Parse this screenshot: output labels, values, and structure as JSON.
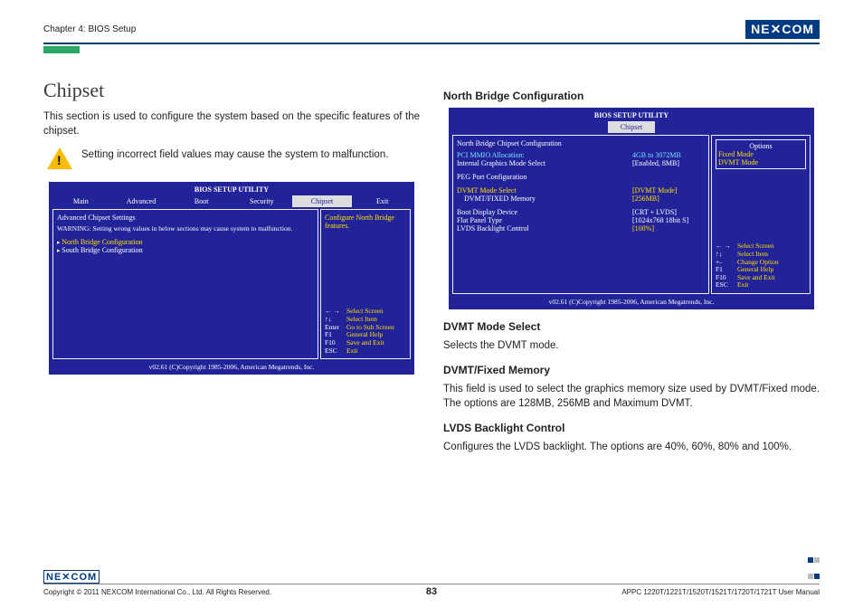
{
  "header": {
    "chapter": "Chapter 4: BIOS Setup",
    "brand": "NE COM"
  },
  "left": {
    "h1": "Chipset",
    "intro": "This section is used to configure the system based on the specific features of the chipset.",
    "warn": "Setting incorrect field values may cause the system to malfunction.",
    "bios": {
      "title": "BIOS SETUP UTILITY",
      "menu": [
        "Main",
        "Advanced",
        "Boot",
        "Security",
        "Chipset",
        "Exit"
      ],
      "menu_sel": "Chipset",
      "heading": "Advanced Chipset Settings",
      "warning": "WARNING: Setting wrong values in below sections may cause system to malfunction.",
      "items": [
        "North Bridge Configuration",
        "South Bridge Configuration"
      ],
      "help": "Configure North Bridge features.",
      "nav": [
        {
          "k": "← →",
          "v": "Select Screen"
        },
        {
          "k": "↑↓",
          "v": "Select Item"
        },
        {
          "k": "Enter",
          "v": "Go to Sub Screen"
        },
        {
          "k": "F1",
          "v": "General Help"
        },
        {
          "k": "F10",
          "v": "Save and Exit"
        },
        {
          "k": "ESC",
          "v": "Exit"
        }
      ],
      "copyright": "v02.61 (C)Copyright 1985-2006, American Megatrends, Inc."
    }
  },
  "right": {
    "h3a": "North Bridge Configuration",
    "bios": {
      "title": "BIOS SETUP UTILITY",
      "tab": "Chipset",
      "heading": "North Bridge Chipset Configuration",
      "rows1": [
        {
          "k": "PCI MMIO Allocation:",
          "v": "4GB to 3072MB",
          "c": "cy"
        },
        {
          "k": "Internal Graphics Mode Select",
          "v": "[Enabled, 8MB]",
          "c": "wht"
        }
      ],
      "peg": "PEG Port Configuration",
      "rows2": [
        {
          "k": "DVMT Mode Select",
          "v": "[DVMT Mode]",
          "c": "yel",
          "kc": "yel"
        },
        {
          "k": "DVMT/FIXED Memory",
          "v": "[256MB]",
          "c": "yel",
          "kc": "wht"
        }
      ],
      "rows3": [
        {
          "k": "Boot Display Device",
          "v": "[CRT + LVDS]",
          "c": "wht"
        },
        {
          "k": "Flat Panel Type",
          "v": "[1024x768 18bit S]",
          "c": "wht"
        },
        {
          "k": "LVDS Backlight Control",
          "v": "[100%]",
          "c": "yel"
        }
      ],
      "opt_title": "Options",
      "opts": [
        "Fixed Mode",
        "DVMT Mode"
      ],
      "nav": [
        {
          "k": "← →",
          "v": "Select Screen"
        },
        {
          "k": "↑↓",
          "v": "Select Item"
        },
        {
          "k": "+-",
          "v": "Change Option"
        },
        {
          "k": "F1",
          "v": "General Help"
        },
        {
          "k": "F10",
          "v": "Save and Exit"
        },
        {
          "k": "ESC",
          "v": "Exit"
        }
      ],
      "copyright": "v02.61 (C)Copyright 1985-2006, American Megatrends, Inc."
    },
    "s1t": "DVMT Mode Select",
    "s1p": "Selects the DVMT mode.",
    "s2t": "DVMT/Fixed Memory",
    "s2p": "This field is used to select the graphics memory size used by DVMT/Fixed mode. The options are 128MB, 256MB and Maximum DVMT.",
    "s3t": "LVDS Backlight Control",
    "s3p": "Configures the LVDS backlight. The options are 40%, 60%, 80% and 100%."
  },
  "footer": {
    "brand": "NE COM",
    "copy": "Copyright © 2011 NEXCOM International Co., Ltd. All Rights Reserved.",
    "page": "83",
    "doc": "APPC 1220T/1221T/1520T/1521T/1720T/1721T User Manual"
  }
}
